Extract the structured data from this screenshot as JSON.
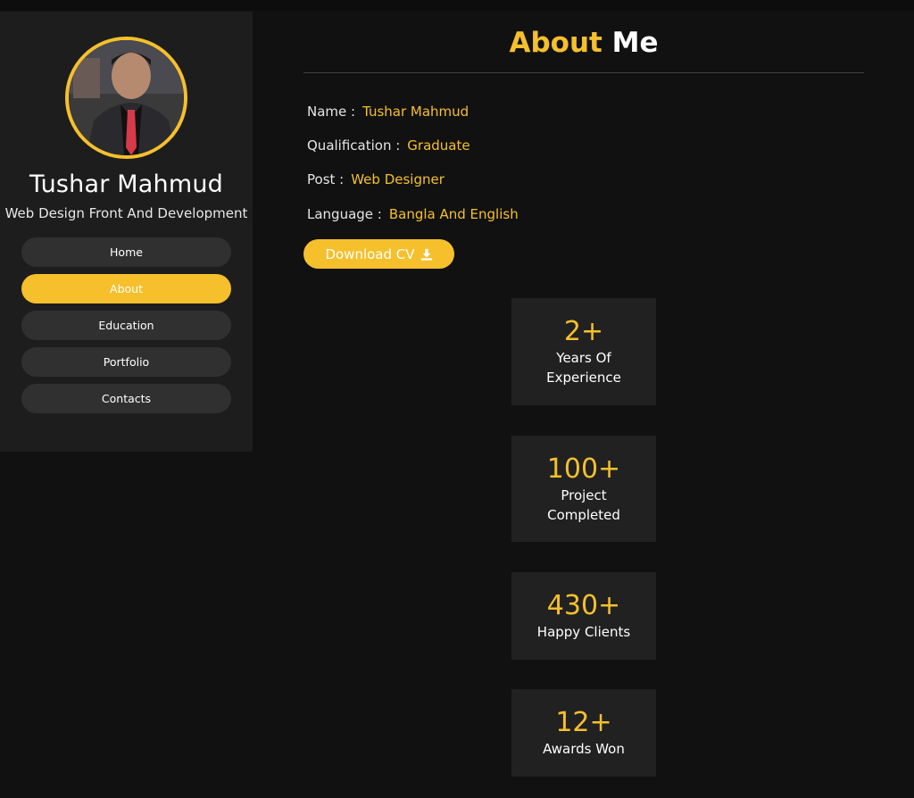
{
  "profile": {
    "name": "Tushar Mahmud",
    "role": "Web Design Front And Development"
  },
  "nav": {
    "items": [
      {
        "label": "Home"
      },
      {
        "label": "About"
      },
      {
        "label": "Education"
      },
      {
        "label": "Portfolio"
      },
      {
        "label": "Contacts"
      }
    ],
    "active": "About"
  },
  "main": {
    "title_accent": "About",
    "title_rest": "Me",
    "info": [
      {
        "label": "Name :",
        "value": "Tushar Mahmud"
      },
      {
        "label": "Qualification :",
        "value": "Graduate"
      },
      {
        "label": "Post :",
        "value": "Web Designer"
      },
      {
        "label": "Language :",
        "value": "Bangla And English"
      }
    ],
    "cv_button": "Download CV",
    "cv_icon": "download-icon"
  },
  "stats": [
    {
      "number": "2+",
      "label": "Years Of Experience"
    },
    {
      "number": "100+",
      "label": "Project Completed"
    },
    {
      "number": "430+",
      "label": "Happy Clients"
    },
    {
      "number": "12+",
      "label": "Awards Won"
    }
  ],
  "colors": {
    "accent": "#f5c02c",
    "background": "#111111",
    "sidebar": "#1d1d1d",
    "card": "#212121",
    "nav_button": "#303030"
  }
}
